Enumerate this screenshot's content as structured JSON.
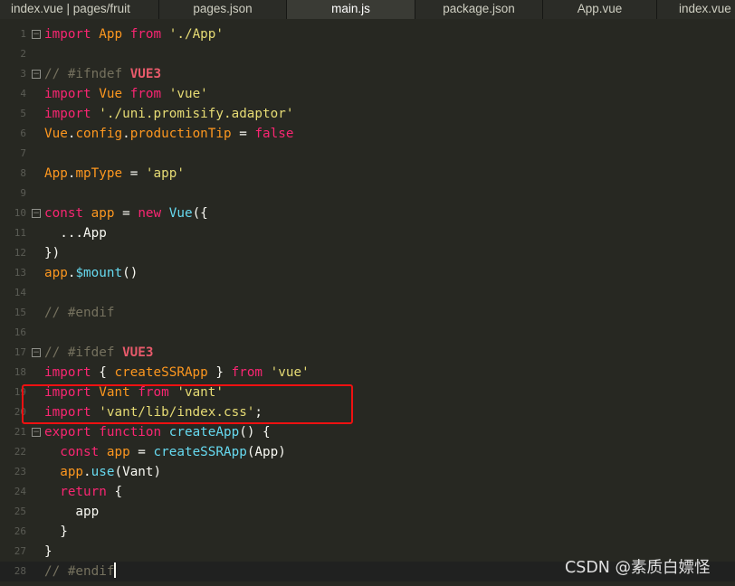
{
  "tabs": [
    {
      "label": "index.vue | pages/fruit",
      "active": false
    },
    {
      "label": "pages.json",
      "active": false
    },
    {
      "label": "main.js",
      "active": true
    },
    {
      "label": "package.json",
      "active": false
    },
    {
      "label": "App.vue",
      "active": false
    },
    {
      "label": "index.vue",
      "active": false
    }
  ],
  "lines": [
    {
      "n": "1",
      "fold": true,
      "tokens": [
        [
          "kw",
          "import"
        ],
        [
          "sep",
          " "
        ],
        [
          "var",
          "App"
        ],
        [
          "sep",
          " "
        ],
        [
          "kw",
          "from"
        ],
        [
          "sep",
          " "
        ],
        [
          "str",
          "'./App'"
        ]
      ]
    },
    {
      "n": "2",
      "tokens": []
    },
    {
      "n": "3",
      "fold": true,
      "tokens": [
        [
          "cmt",
          "// #ifndef "
        ],
        [
          "dir",
          "VUE3"
        ]
      ]
    },
    {
      "n": "4",
      "tokens": [
        [
          "kw",
          "import"
        ],
        [
          "sep",
          " "
        ],
        [
          "var",
          "Vue"
        ],
        [
          "sep",
          " "
        ],
        [
          "kw",
          "from"
        ],
        [
          "sep",
          " "
        ],
        [
          "str",
          "'vue'"
        ]
      ]
    },
    {
      "n": "5",
      "tokens": [
        [
          "kw",
          "import"
        ],
        [
          "sep",
          " "
        ],
        [
          "str",
          "'./uni.promisify.adaptor'"
        ]
      ]
    },
    {
      "n": "6",
      "tokens": [
        [
          "var",
          "Vue"
        ],
        [
          "plain",
          "."
        ],
        [
          "var",
          "config"
        ],
        [
          "plain",
          "."
        ],
        [
          "var",
          "productionTip"
        ],
        [
          "plain",
          " = "
        ],
        [
          "kw",
          "false"
        ]
      ]
    },
    {
      "n": "7",
      "tokens": []
    },
    {
      "n": "8",
      "tokens": [
        [
          "var",
          "App"
        ],
        [
          "plain",
          "."
        ],
        [
          "var",
          "mpType"
        ],
        [
          "plain",
          " = "
        ],
        [
          "str",
          "'app'"
        ]
      ]
    },
    {
      "n": "9",
      "tokens": []
    },
    {
      "n": "10",
      "fold": true,
      "tokens": [
        [
          "kw",
          "const"
        ],
        [
          "sep",
          " "
        ],
        [
          "var",
          "app"
        ],
        [
          "plain",
          " = "
        ],
        [
          "kw",
          "new"
        ],
        [
          "sep",
          " "
        ],
        [
          "fn",
          "Vue"
        ],
        [
          "plain",
          "({"
        ]
      ]
    },
    {
      "n": "11",
      "tokens": [
        [
          "plain",
          "  ..."
        ],
        [
          "plain",
          "App"
        ]
      ]
    },
    {
      "n": "12",
      "tokens": [
        [
          "plain",
          "})"
        ]
      ]
    },
    {
      "n": "13",
      "tokens": [
        [
          "var",
          "app"
        ],
        [
          "plain",
          "."
        ],
        [
          "fn",
          "$mount"
        ],
        [
          "plain",
          "()"
        ]
      ]
    },
    {
      "n": "14",
      "tokens": []
    },
    {
      "n": "15",
      "tokens": [
        [
          "cmt",
          "// #endif"
        ]
      ]
    },
    {
      "n": "16",
      "tokens": []
    },
    {
      "n": "17",
      "fold": true,
      "tokens": [
        [
          "cmt",
          "// #ifdef "
        ],
        [
          "dir",
          "VUE3"
        ]
      ]
    },
    {
      "n": "18",
      "tokens": [
        [
          "kw",
          "import"
        ],
        [
          "plain",
          " { "
        ],
        [
          "var",
          "createSSRApp"
        ],
        [
          "plain",
          " } "
        ],
        [
          "kw",
          "from"
        ],
        [
          "sep",
          " "
        ],
        [
          "str",
          "'vue'"
        ]
      ]
    },
    {
      "n": "19",
      "tokens": [
        [
          "kw",
          "import"
        ],
        [
          "sep",
          " "
        ],
        [
          "var",
          "Vant"
        ],
        [
          "sep",
          " "
        ],
        [
          "kw",
          "from"
        ],
        [
          "sep",
          " "
        ],
        [
          "str",
          "'vant'"
        ]
      ]
    },
    {
      "n": "20",
      "tokens": [
        [
          "kw",
          "import"
        ],
        [
          "sep",
          " "
        ],
        [
          "str",
          "'vant/lib/index.css'"
        ],
        [
          "plain",
          ";"
        ]
      ]
    },
    {
      "n": "21",
      "fold": true,
      "tokens": [
        [
          "kw",
          "export"
        ],
        [
          "sep",
          " "
        ],
        [
          "kw",
          "function"
        ],
        [
          "sep",
          " "
        ],
        [
          "fn",
          "createApp"
        ],
        [
          "plain",
          "() {"
        ]
      ]
    },
    {
      "n": "22",
      "tokens": [
        [
          "plain",
          "  "
        ],
        [
          "kw",
          "const"
        ],
        [
          "sep",
          " "
        ],
        [
          "var",
          "app"
        ],
        [
          "plain",
          " = "
        ],
        [
          "fn",
          "createSSRApp"
        ],
        [
          "plain",
          "(App)"
        ]
      ]
    },
    {
      "n": "23",
      "tokens": [
        [
          "plain",
          "  "
        ],
        [
          "var",
          "app"
        ],
        [
          "plain",
          "."
        ],
        [
          "fn",
          "use"
        ],
        [
          "plain",
          "(Vant)"
        ]
      ]
    },
    {
      "n": "24",
      "tokens": [
        [
          "plain",
          "  "
        ],
        [
          "kw",
          "return"
        ],
        [
          "plain",
          " {"
        ]
      ]
    },
    {
      "n": "25",
      "tokens": [
        [
          "plain",
          "    app"
        ]
      ]
    },
    {
      "n": "26",
      "tokens": [
        [
          "plain",
          "  }"
        ]
      ]
    },
    {
      "n": "27",
      "tokens": [
        [
          "plain",
          "}"
        ]
      ]
    },
    {
      "n": "28",
      "current": true,
      "cursor": true,
      "tokens": [
        [
          "cmt",
          "// #endif"
        ]
      ]
    }
  ],
  "watermark": "CSDN @素质白嫖怪",
  "colors": {
    "background": "#272822",
    "keyword": "#f92672",
    "string": "#e6db74",
    "comment": "#75715e",
    "function": "#66d9ef",
    "identifier": "#fd971f",
    "highlight_box": "#ee1111"
  }
}
